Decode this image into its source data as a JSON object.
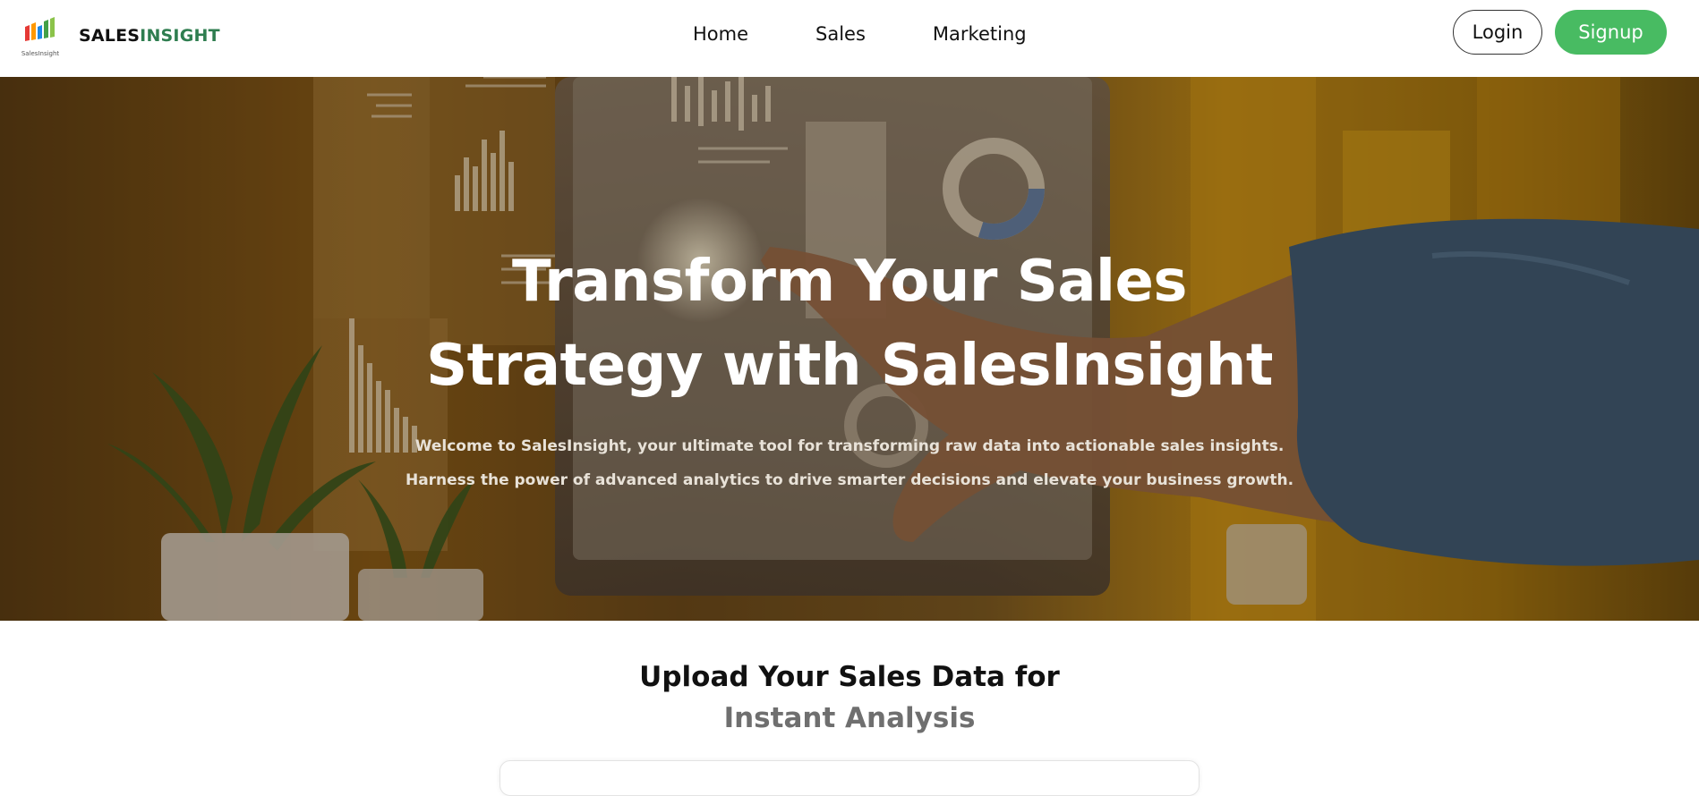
{
  "brand": {
    "name_part1": "SALES",
    "name_part2": "INSIGHT",
    "logo_caption": "SalesInsight",
    "accent": "#2e7d4f"
  },
  "nav": {
    "items": [
      "Home",
      "Sales",
      "Marketing"
    ]
  },
  "auth": {
    "login_label": "Login",
    "signup_label": "Signup",
    "signup_color": "#48bb62"
  },
  "hero": {
    "title_line1": "Transform Your Sales",
    "title_line2": "Strategy with SalesInsight",
    "subtitle_line1": "Welcome to SalesInsight, your ultimate tool for transforming raw data into actionable sales insights.",
    "subtitle_line2": "Harness the power of advanced analytics to drive smarter decisions and elevate your business growth.",
    "background_image": "hand-pointing-at-analytics-dashboard-photo"
  },
  "upload": {
    "title_line1": "Upload Your Sales Data for",
    "title_line2": "Instant Analysis"
  }
}
